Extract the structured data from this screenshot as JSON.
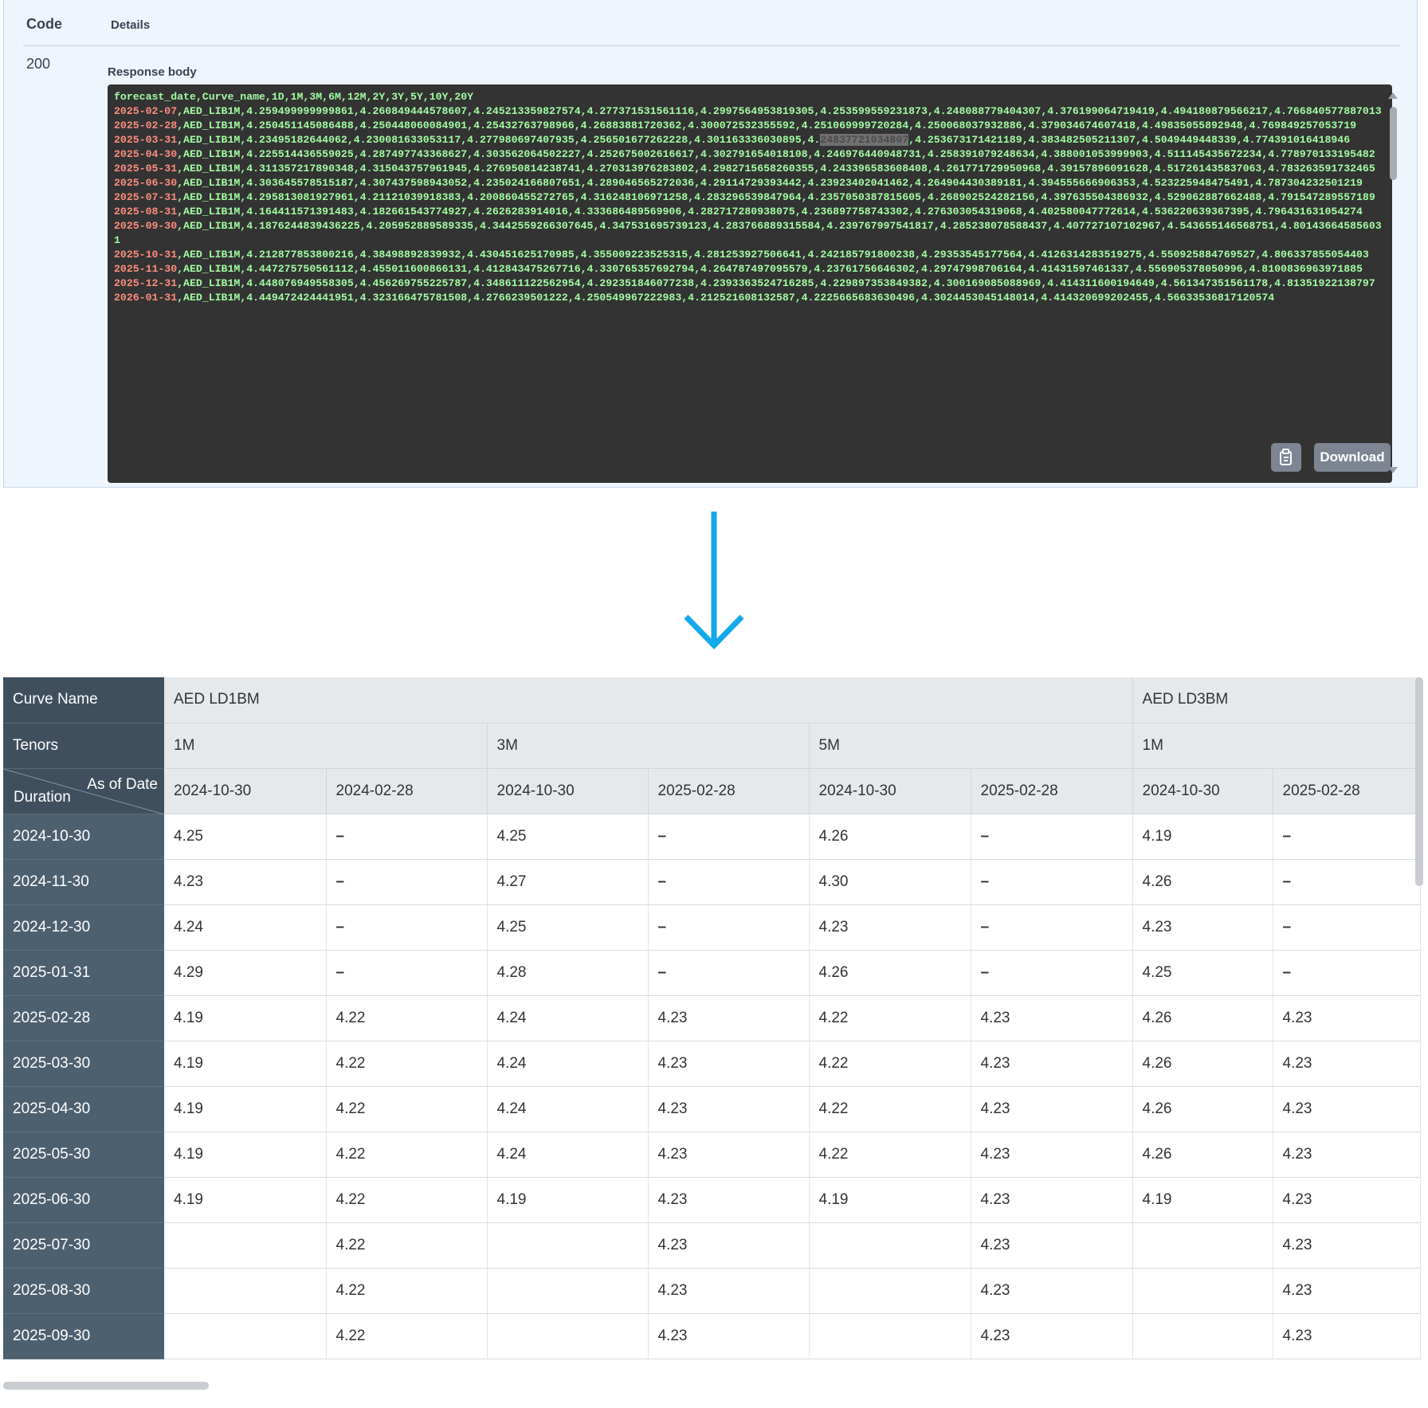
{
  "response": {
    "col_code": "Code",
    "col_details": "Details",
    "status_code": "200",
    "body_label": "Response body",
    "header_line": "forecast_date,Curve_name,1D,1M,3M,6M,12M,2Y,3Y,5Y,10Y,20Y",
    "rows": [
      {
        "date": "2025-02-07",
        "rest": ",AED_LIB1M,4.259499999999861,4.260849444578607,4.245213359827574,4.277371531561116,4.2997564953819305,4.253599559231873,4.248088779404307,4.376199064719419,4.494180879566217,4.766840577887013"
      },
      {
        "date": "2025-02-28",
        "rest": ",AED_LIB1M,4.250451145086488,4.250448060084901,4.25432763798966,4.26883881720362,4.300072532355592,4.251069999720284,4.250068037932886,4.379034674607418,4.49835055892948,4.769849257053719"
      },
      {
        "date": "2025-03-31",
        "rest_a": ",AED_LIB1M,4.23495182644062,4.230081633053117,4.277980697407935,4.256501677262228,4.301163336030895,4.",
        "highlight": "24837721034807",
        "rest_b": ",4.253673171421189,4.383482505211307,4.5049449448339,4.774391016418946"
      },
      {
        "date": "2025-04-30",
        "rest": ",AED_LIB1M,4.225514436559025,4.287497743368627,4.303562064502227,4.252675002616617,4.302791654018108,4.246976440948731,4.258391079248634,4.388001053999903,4.511145435672234,4.778970133195482"
      },
      {
        "date": "2025-05-31",
        "rest": ",AED_LIB1M,4.311357217890348,4.315043757961945,4.276950814238741,4.270313976283802,4.2982715658260355,4.243396583608408,4.261771729950968,4.39157896091628,4.517261435837063,4.783263591732465"
      },
      {
        "date": "2025-06-30",
        "rest": ",AED_LIB1M,4.303645578515187,4.307437598943052,4.235024166807651,4.289046565272036,4.29114729393442,4.23923402041462,4.264904430389181,4.394555666906353,4.523225948475491,4.787304232501219"
      },
      {
        "date": "2025-07-31",
        "rest": ",AED_LIB1M,4.295813081927961,4.21121039918383,4.200860455272765,4.316248106971258,4.283296539847964,4.2357050387815605,4.268902524282156,4.397635504386932,4.529062887662488,4.791547289557189"
      },
      {
        "date": "2025-08-31",
        "rest": ",AED_LIB1M,4.164411571391483,4.182661543774927,4.2626283914016,4.333686489569906,4.282717280938075,4.236897758743302,4.276303054319068,4.402580047772614,4.536220639367395,4.796431631054274"
      },
      {
        "date": "2025-09-30",
        "rest": ",AED_LIB1M,4.1876244839436225,4.205952889589335,4.3442559266307645,4.347531695739123,4.283766889315584,4.239767997541817,4.285238078588437,4.407727107102967,4.543655146568751,4.801436645856031"
      },
      {
        "date": "2025-10-31",
        "rest": ",AED_LIB1M,4.212877853800216,4.38498892839932,4.430451625170985,4.355009223525315,4.281253927506641,4.242185791800238,4.29353545177564,4.4126314283519275,4.550925884769527,4.806337855054403"
      },
      {
        "date": "2025-11-30",
        "rest": ",AED_LIB1M,4.447275750561112,4.455011600866131,4.412843475267716,4.330765357692794,4.264787497095579,4.23761756646302,4.29747998706164,4.41431597461337,4.556905378050996,4.8100836963971885"
      },
      {
        "date": "2025-12-31",
        "rest": ",AED_LIB1M,4.448076949558305,4.456269755225787,4.348611122562954,4.292351846077238,4.2393363524716285,4.229897353849382,4.300169085088969,4.414311600194649,4.561347351561178,4.81351922138797"
      },
      {
        "date": "2026-01-31",
        "rest": ",AED_LIB1M,4.449472424441951,4.323166475781508,4.2766239501222,4.250549967222983,4.212521608132587,4.2225665683630496,4.3024453045148014,4.414320699202455,4.5663353",
        "tail": "6817120574"
      }
    ],
    "download_label": "Download",
    "copy_icon": "clipboard-icon"
  },
  "arrow": {
    "icon": "arrow-down-icon",
    "color": "#13aaec"
  },
  "table": {
    "curve_name_label": "Curve Name",
    "tenors_label": "Tenors",
    "as_of_date_label": "As of Date",
    "duration_label": "Duration",
    "curves": [
      {
        "name": "AED LD1BM",
        "tenors": [
          "1M",
          "3M",
          "5M"
        ]
      },
      {
        "name": "AED LD3BM",
        "tenors": [
          "1M"
        ]
      }
    ],
    "as_of_dates": [
      "2024-10-30",
      "2024-02-28",
      "2024-10-30",
      "2025-02-28",
      "2024-10-30",
      "2025-02-28",
      "2024-10-30",
      "2025-02-28"
    ],
    "rows": [
      {
        "duration": "2024-10-30",
        "values": [
          "4.25",
          "–",
          "4.25",
          "–",
          "4.26",
          "–",
          "4.19",
          "–"
        ]
      },
      {
        "duration": "2024-11-30",
        "values": [
          "4.23",
          "–",
          "4.27",
          "–",
          "4.30",
          "–",
          "4.26",
          "–"
        ]
      },
      {
        "duration": "2024-12-30",
        "values": [
          "4.24",
          "–",
          "4.25",
          "–",
          "4.23",
          "–",
          "4.23",
          "–"
        ]
      },
      {
        "duration": "2025-01-31",
        "values": [
          "4.29",
          "–",
          "4.28",
          "–",
          "4.26",
          "–",
          "4.25",
          "–"
        ]
      },
      {
        "duration": "2025-02-28",
        "values": [
          "4.19",
          "4.22",
          "4.24",
          "4.23",
          "4.22",
          "4.23",
          "4.26",
          "4.23"
        ]
      },
      {
        "duration": "2025-03-30",
        "values": [
          "4.19",
          "4.22",
          "4.24",
          "4.23",
          "4.22",
          "4.23",
          "4.26",
          "4.23"
        ]
      },
      {
        "duration": "2025-04-30",
        "values": [
          "4.19",
          "4.22",
          "4.24",
          "4.23",
          "4.22",
          "4.23",
          "4.26",
          "4.23"
        ]
      },
      {
        "duration": "2025-05-30",
        "values": [
          "4.19",
          "4.22",
          "4.24",
          "4.23",
          "4.22",
          "4.23",
          "4.26",
          "4.23"
        ]
      },
      {
        "duration": "2025-06-30",
        "values": [
          "4.19",
          "4.22",
          "4.19",
          "4.23",
          "4.19",
          "4.23",
          "4.19",
          "4.23"
        ]
      },
      {
        "duration": "2025-07-30",
        "values": [
          "",
          "4.22",
          "",
          "4.23",
          "",
          "4.23",
          "",
          "4.23"
        ]
      },
      {
        "duration": "2025-08-30",
        "values": [
          "",
          "4.22",
          "",
          "4.23",
          "",
          "4.23",
          "",
          "4.23"
        ]
      },
      {
        "duration": "2025-09-30",
        "values": [
          "",
          "4.22",
          "",
          "4.23",
          "",
          "4.23",
          "",
          "4.23"
        ]
      }
    ]
  }
}
